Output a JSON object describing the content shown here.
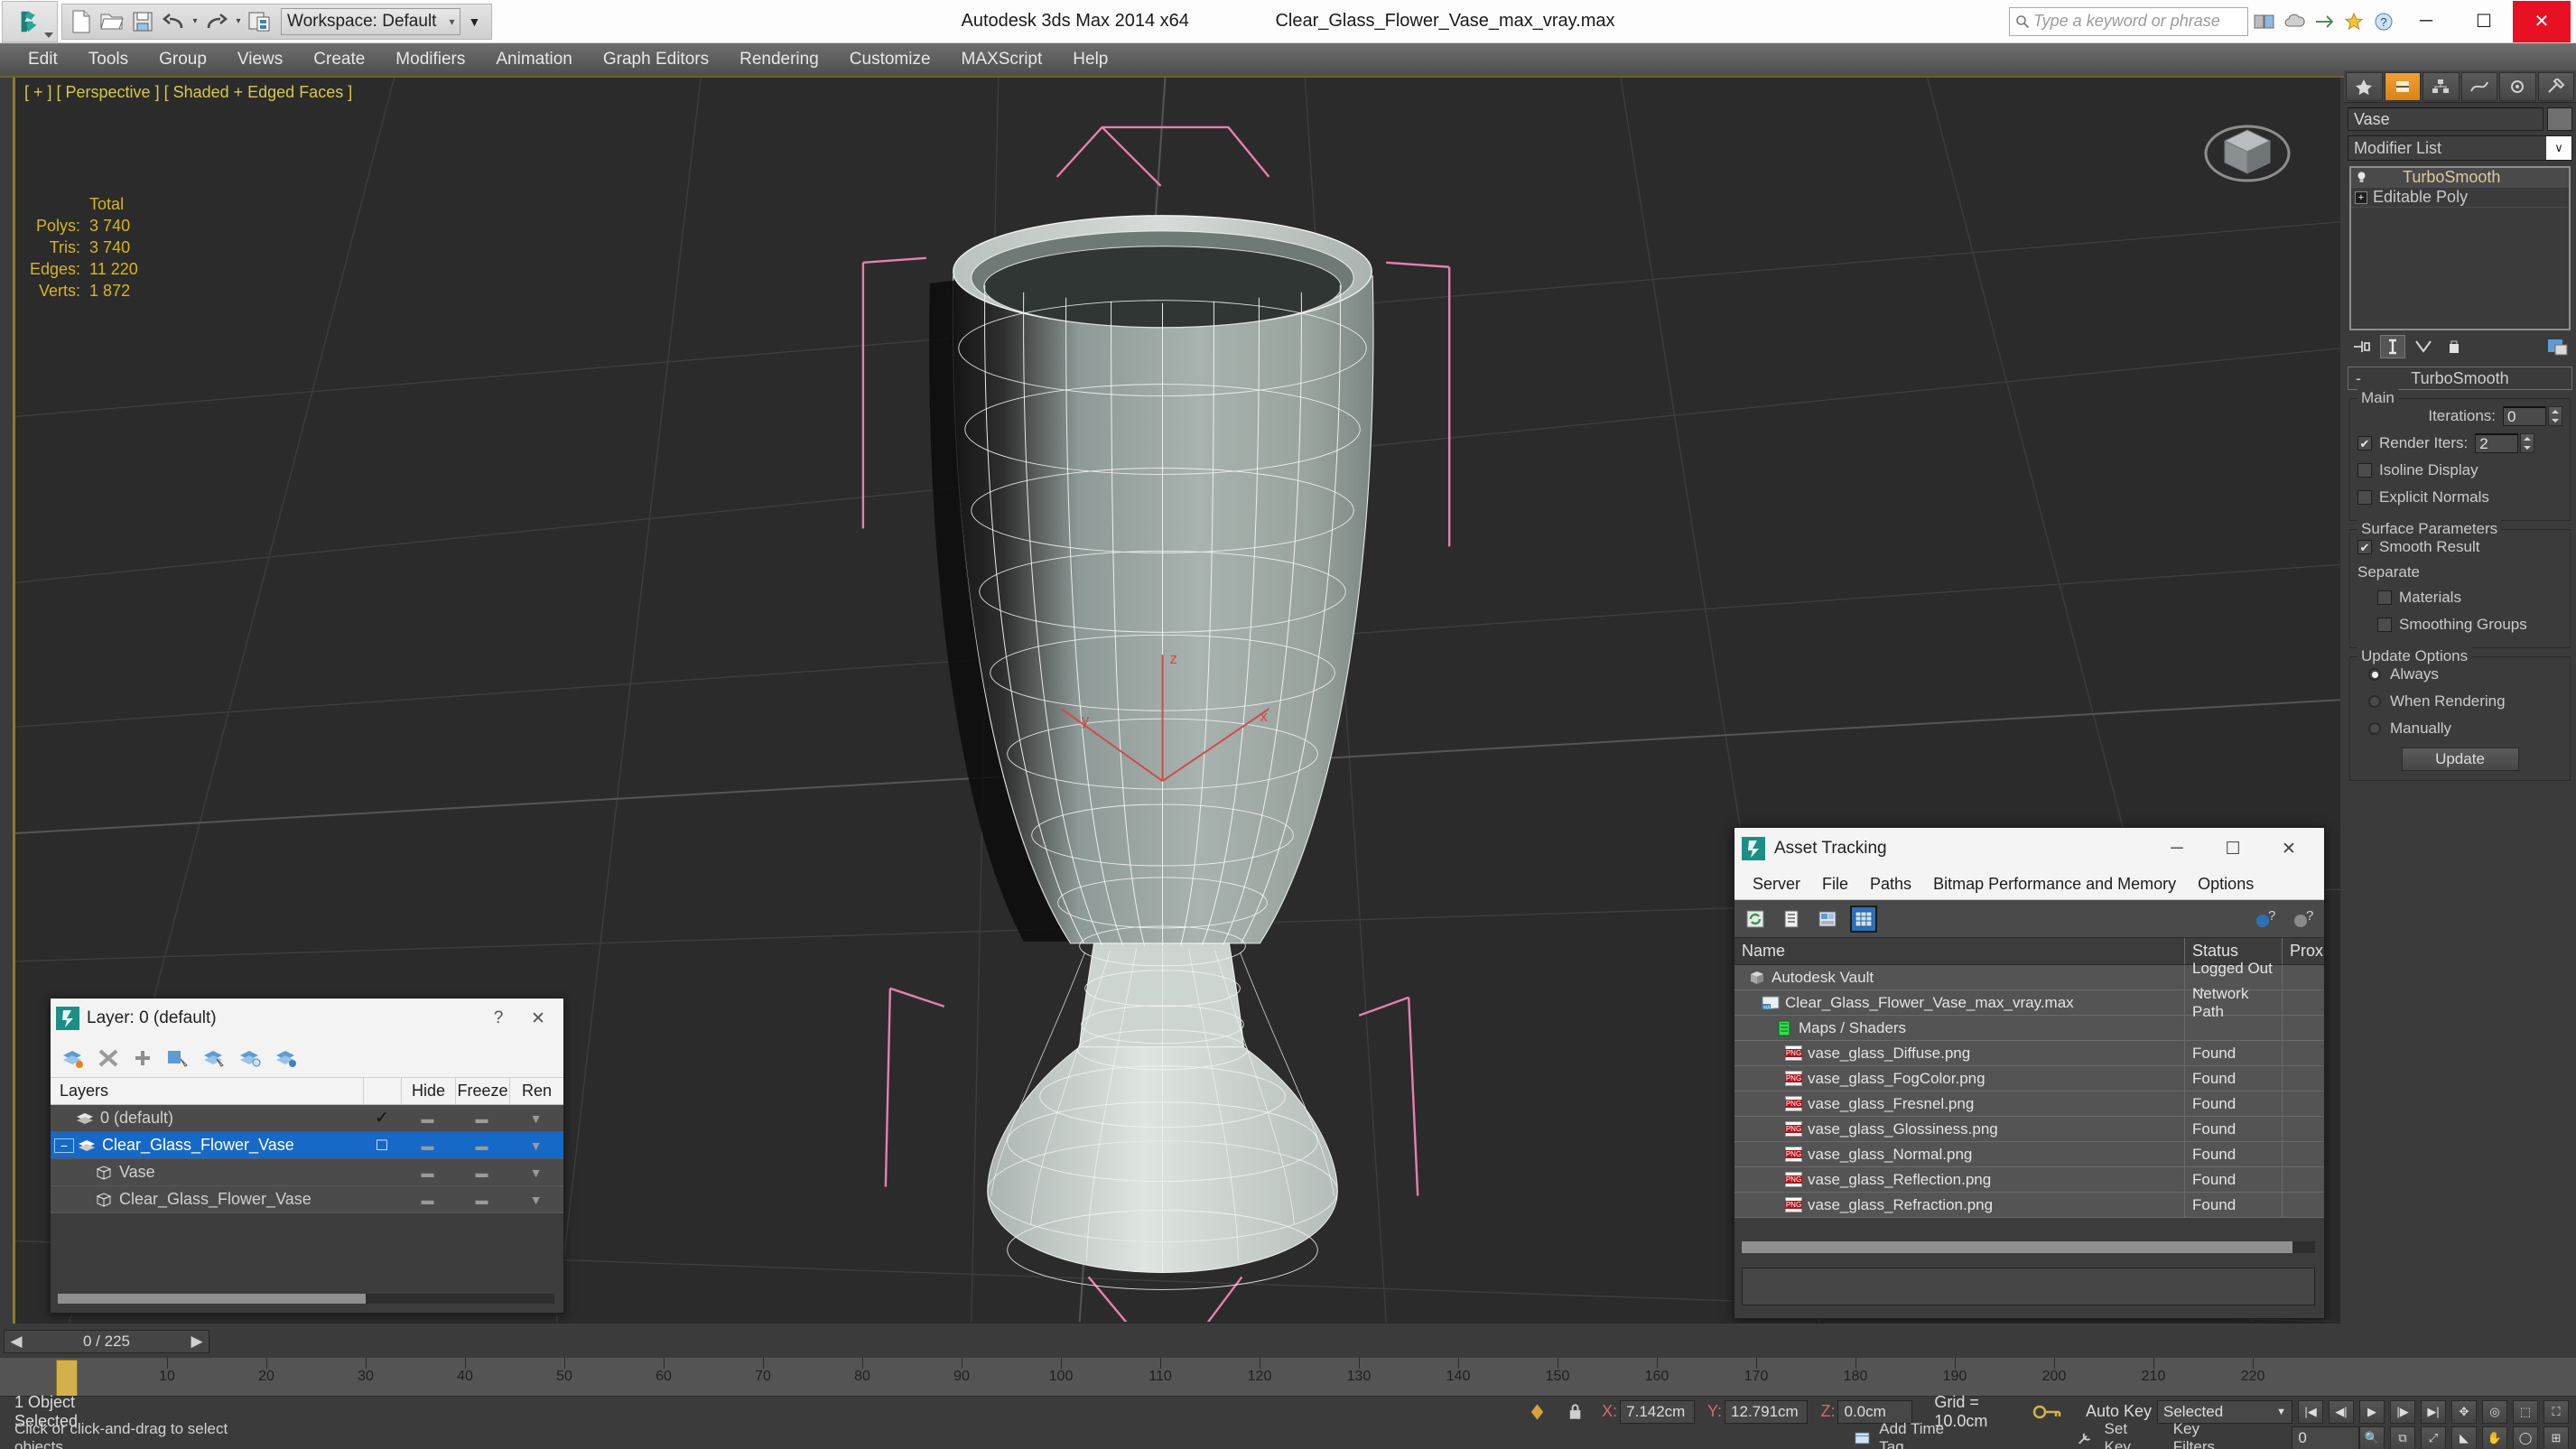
{
  "titlebar": {
    "app_title": "Autodesk 3ds Max  2014 x64",
    "file_name": "Clear_Glass_Flower_Vase_max_vray.max",
    "workspace_label": "Workspace: Default",
    "search_placeholder": "Type a keyword or phrase",
    "minimize": "─",
    "maximize": "☐",
    "close": "✕"
  },
  "menubar": {
    "items": [
      "Edit",
      "Tools",
      "Group",
      "Views",
      "Create",
      "Modifiers",
      "Animation",
      "Graph Editors",
      "Rendering",
      "Customize",
      "MAXScript",
      "Help"
    ]
  },
  "viewport": {
    "label": "[ + ] [ Perspective ] [ Shaded + Edged Faces ]",
    "stats": {
      "header": "Total",
      "rows": [
        {
          "label": "Polys:",
          "value": "3 740"
        },
        {
          "label": "Tris:",
          "value": "3 740"
        },
        {
          "label": "Edges:",
          "value": "11 220"
        },
        {
          "label": "Verts:",
          "value": "1 872"
        }
      ]
    },
    "axis": {
      "x": "x",
      "y": "y",
      "z": "z"
    }
  },
  "command_panel": {
    "object_name": "Vase",
    "modifier_list_label": "Modifier List",
    "stack": [
      {
        "label": "TurboSmooth",
        "selected": true
      },
      {
        "label": "Editable Poly",
        "selected": false
      }
    ],
    "rollup_title": "TurboSmooth",
    "main": {
      "group_label": "Main",
      "iterations_label": "Iterations:",
      "iterations_value": "0",
      "render_iters_label": "Render Iters:",
      "render_iters_value": "2",
      "render_iters_checked": true,
      "isoline_label": "Isoline Display",
      "isoline_checked": false,
      "explicit_label": "Explicit Normals",
      "explicit_checked": false
    },
    "surface": {
      "group_label": "Surface Parameters",
      "smooth_result_label": "Smooth Result",
      "smooth_result_checked": true,
      "separate_label": "Separate",
      "materials_label": "Materials",
      "materials_checked": false,
      "smoothing_groups_label": "Smoothing Groups",
      "smoothing_groups_checked": false
    },
    "update": {
      "group_label": "Update Options",
      "options": [
        "Always",
        "When Rendering",
        "Manually"
      ],
      "selected": "Always",
      "button_label": "Update"
    }
  },
  "layer_dialog": {
    "title": "Layer: 0 (default)",
    "help_glyph": "?",
    "close_glyph": "✕",
    "columns": {
      "layers": "Layers",
      "hide": "Hide",
      "freeze": "Freeze",
      "render": "Ren"
    },
    "rows": [
      {
        "name": "0 (default)",
        "indent": 1,
        "check": "✓",
        "hide": "",
        "freeze": "",
        "selected": false,
        "expander": ""
      },
      {
        "name": "Clear_Glass_Flower_Vase",
        "indent": 0,
        "check": "□",
        "hide": "",
        "freeze": "",
        "selected": true,
        "expander": "−"
      },
      {
        "name": "Vase",
        "indent": 2,
        "check": "",
        "hide": "",
        "freeze": "",
        "selected": false,
        "expander": ""
      },
      {
        "name": "Clear_Glass_Flower_Vase",
        "indent": 2,
        "check": "",
        "hide": "",
        "freeze": "",
        "selected": false,
        "expander": ""
      }
    ]
  },
  "asset_tracking": {
    "title": "Asset Tracking",
    "minimize": "─",
    "maximize": "☐",
    "close": "✕",
    "menu": [
      "Server",
      "File",
      "Paths",
      "Bitmap Performance and Memory",
      "Options"
    ],
    "columns": {
      "name": "Name",
      "status": "Status",
      "proxy": "Prox"
    },
    "rows": [
      {
        "name": "Autodesk Vault",
        "status": "Logged Out ...",
        "indent": 0,
        "icon": "vault-icon"
      },
      {
        "name": "Clear_Glass_Flower_Vase_max_vray.max",
        "status": "Network Path",
        "indent": 1,
        "icon": "max-file-icon"
      },
      {
        "name": "Maps / Shaders",
        "status": "",
        "indent": 2,
        "icon": "maps-icon"
      },
      {
        "name": "vase_glass_Diffuse.png",
        "status": "Found",
        "indent": 3,
        "icon": "png-icon"
      },
      {
        "name": "vase_glass_FogColor.png",
        "status": "Found",
        "indent": 3,
        "icon": "png-icon"
      },
      {
        "name": "vase_glass_Fresnel.png",
        "status": "Found",
        "indent": 3,
        "icon": "png-icon"
      },
      {
        "name": "vase_glass_Glossiness.png",
        "status": "Found",
        "indent": 3,
        "icon": "png-icon"
      },
      {
        "name": "vase_glass_Normal.png",
        "status": "Found",
        "indent": 3,
        "icon": "png-icon"
      },
      {
        "name": "vase_glass_Reflection.png",
        "status": "Found",
        "indent": 3,
        "icon": "png-icon"
      },
      {
        "name": "vase_glass_Refraction.png",
        "status": "Found",
        "indent": 3,
        "icon": "png-icon"
      }
    ]
  },
  "timeline": {
    "frame_range": "0 / 225",
    "prev_glyph": "◀",
    "next_glyph": "▶",
    "ticks": [
      "10",
      "20",
      "30",
      "40",
      "50",
      "60",
      "70",
      "80",
      "90",
      "100",
      "110",
      "120",
      "130",
      "140",
      "150",
      "160",
      "170",
      "180",
      "190",
      "200",
      "210",
      "220"
    ]
  },
  "statusbar": {
    "selection_text": "1 Object Selected",
    "prompt_text": "Click or click-and-drag to select objects",
    "add_time_tag": "Add Time Tag",
    "coords": [
      {
        "label": "X:",
        "value": "7.142cm"
      },
      {
        "label": "Y:",
        "value": "12.791cm"
      },
      {
        "label": "Z:",
        "value": "0.0cm"
      }
    ],
    "grid_text": "Grid = 10.0cm",
    "auto_key": "Auto Key",
    "set_key": "Set Key",
    "key_filters": "Key Filters...",
    "selected_combo": "Selected",
    "key_value": "0"
  },
  "colors": {
    "accent_orange": "#d8831a",
    "highlight_blue": "#1669c7",
    "viewport_bg": "#2b2b2b",
    "stat_yellow": "#d6b522",
    "gizmo_pink": "#e87fae"
  }
}
